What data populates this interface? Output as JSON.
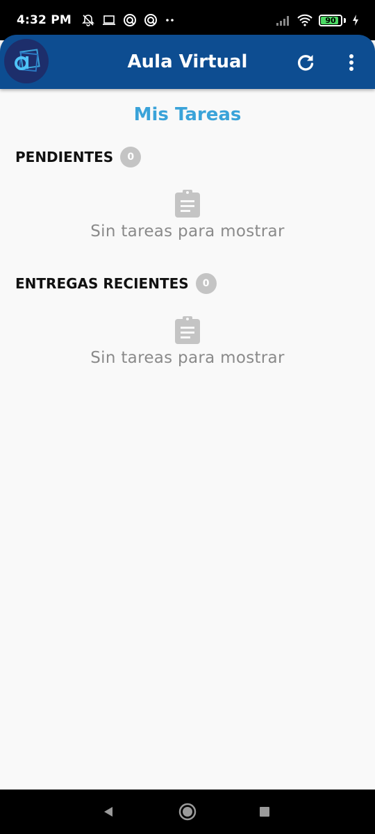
{
  "status_bar": {
    "time": "4:32 PM",
    "battery_level": "90",
    "icons": [
      "muted-bell-icon",
      "laptop-icon",
      "app-notification-icon",
      "app-notification-icon",
      "more-dots-icon",
      "signal-icon",
      "wifi-icon",
      "battery-icon",
      "charging-icon"
    ]
  },
  "app_bar": {
    "title": "Aula Virtual",
    "logo_icon": "aula-virtual-logo",
    "refresh_icon": "refresh-icon",
    "menu_icon": "more-vert-icon",
    "color": "#0d4d91"
  },
  "page": {
    "title": "Mis Tareas",
    "title_color": "#3aa3d9"
  },
  "sections": [
    {
      "title": "PENDIENTES",
      "count": "0",
      "empty_icon": "clipboard-icon",
      "empty_text": "Sin tareas para mostrar"
    },
    {
      "title": "ENTREGAS RECIENTES",
      "count": "0",
      "empty_icon": "clipboard-icon",
      "empty_text": "Sin tareas para mostrar"
    }
  ],
  "nav_bar": {
    "buttons": [
      "back-icon",
      "home-icon",
      "recents-icon"
    ]
  }
}
